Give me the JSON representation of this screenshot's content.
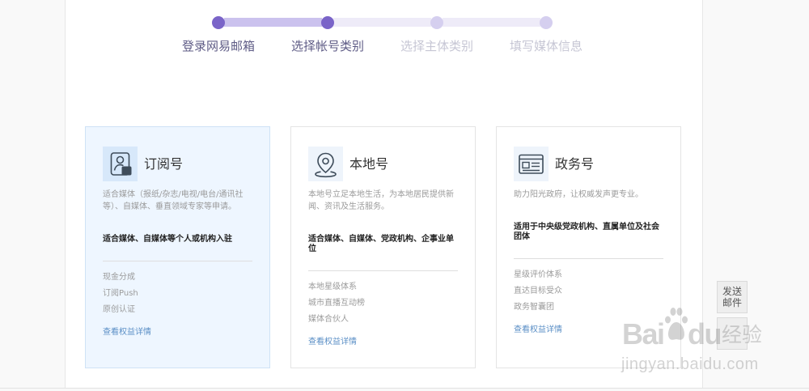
{
  "steps": [
    {
      "label": "登录网易邮箱",
      "reached": true
    },
    {
      "label": "选择帐号类别",
      "reached": true
    },
    {
      "label": "选择主体类别",
      "reached": false
    },
    {
      "label": "填写媒体信息",
      "reached": false
    }
  ],
  "account_types": [
    {
      "icon": "subscription-badge-icon",
      "title": "订阅号",
      "description": "适合媒体（报纸/杂志/电视/电台/通讯社等）、自媒体、垂直领域专家等申请。",
      "audience": "适合媒体、自媒体等个人或机构入驻",
      "benefits": [
        "现金分成",
        "订阅Push",
        "原创认证"
      ],
      "link": "查看权益详情",
      "selected": true
    },
    {
      "icon": "location-pin-icon",
      "title": "本地号",
      "description": "本地号立足本地生活，为本地居民提供新闻、资讯及生活服务。",
      "audience": "适合媒体、自媒体、党政机构、企事业单位",
      "benefits": [
        "本地星级体系",
        "城市直播互动榜",
        "媒体合伙人"
      ],
      "link": "查看权益详情",
      "selected": false
    },
    {
      "icon": "government-card-icon",
      "title": "政务号",
      "description": "助力阳光政府，让权威发声更专业。",
      "audience": "适用于中央级党政机构、直属单位及社会团体",
      "benefits": [
        "星级评价体系",
        "直达目标受众",
        "政务智囊团"
      ],
      "link": "查看权益详情",
      "selected": false
    }
  ],
  "float_buttons": {
    "send_email": "发送邮件"
  },
  "watermark": {
    "brand_left": "Bai",
    "brand_right": "du",
    "product": "经验",
    "url": "jingyan.baidu.com"
  },
  "colors": {
    "step_reached": "#7a64c8",
    "step_pending": "#d5cfef",
    "bar_reached": "#cbc2ee",
    "bar_pending": "#eeebf8",
    "label_reached": "#5f5c86",
    "label_pending": "#c6c6d4",
    "link": "#5b8fc6",
    "selected_card_bg": "#eef6ff",
    "selected_card_border": "#cfe2f6"
  }
}
